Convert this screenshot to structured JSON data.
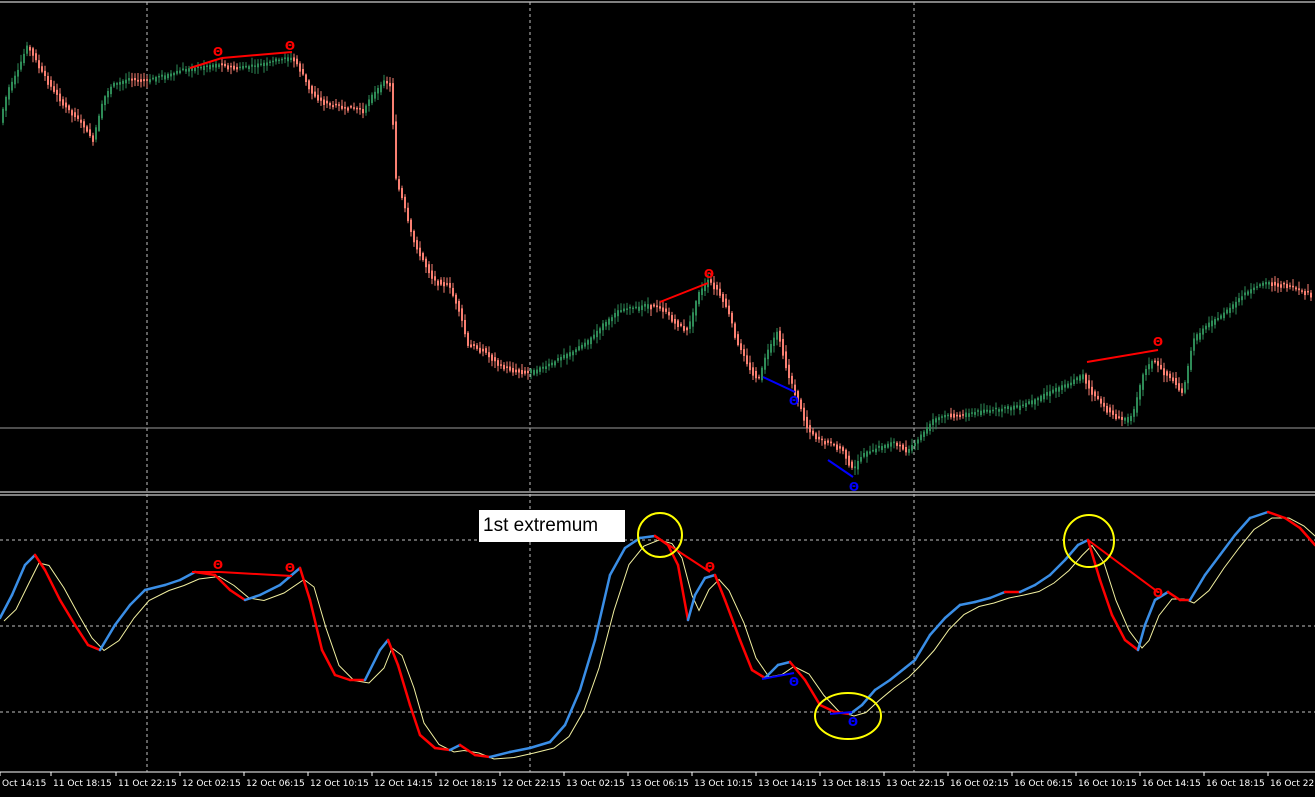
{
  "chart_data": [
    {
      "type": "candlestick",
      "panel": "price",
      "colors": {
        "up": "#2e8b57",
        "down": "#fa8072",
        "grid": "#c0c0c0",
        "hline": "#9a9a9a"
      },
      "note_text": "",
      "series": []
    },
    {
      "type": "line",
      "panel": "oscillator",
      "colors": {
        "rising": "#3a8ee6",
        "falling": "#ff0000",
        "signal": "#f2f0a0",
        "divergence_bear": "#ff0000",
        "divergence_bull": "#0000ff",
        "highlight": "#ffff00"
      },
      "annotation": "1st extremum"
    }
  ],
  "x_axis": {
    "ticks": [
      "Oct 14:15",
      "11 Oct 18:15",
      "11 Oct 22:15",
      "12 Oct 02:15",
      "12 Oct 06:15",
      "12 Oct 10:15",
      "12 Oct 14:15",
      "12 Oct 18:15",
      "12 Oct 22:15",
      "13 Oct 02:15",
      "13 Oct 06:15",
      "13 Oct 10:15",
      "13 Oct 14:15",
      "13 Oct 18:15",
      "13 Oct 22:15",
      "16 Oct 02:15",
      "16 Oct 06:15",
      "16 Oct 10:15",
      "16 Oct 14:15",
      "16 Oct 18:15",
      "16 Oct 22:"
    ]
  }
}
